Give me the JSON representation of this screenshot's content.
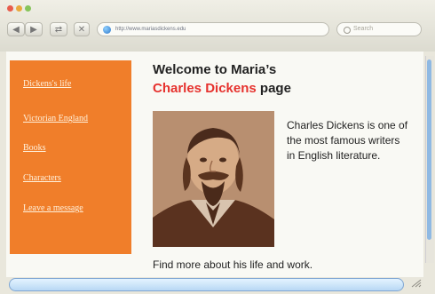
{
  "browser": {
    "url": "http://www.mariasdickens.edu",
    "search_placeholder": "Search",
    "back_label": "◀",
    "forward_label": "▶",
    "refresh_label": "⇄",
    "stop_label": "✕"
  },
  "sidebar": {
    "items": [
      {
        "label": "Dickens's life"
      },
      {
        "label": "Victorian England"
      },
      {
        "label": "Books"
      },
      {
        "label": "Characters"
      },
      {
        "label": "Leave a message"
      }
    ]
  },
  "page": {
    "title_line1": "Welcome to Maria’s",
    "title_line2_highlight": "Charles Dickens",
    "title_line2_rest": " page",
    "intro": "Charles Dickens is one of the most famous writers in English literature.",
    "footer": "Find more about his life and work."
  },
  "colors": {
    "sidebar": "#f07e2a",
    "title_highlight": "#e6312d",
    "scroll_thumb": "#8fb9e3"
  }
}
